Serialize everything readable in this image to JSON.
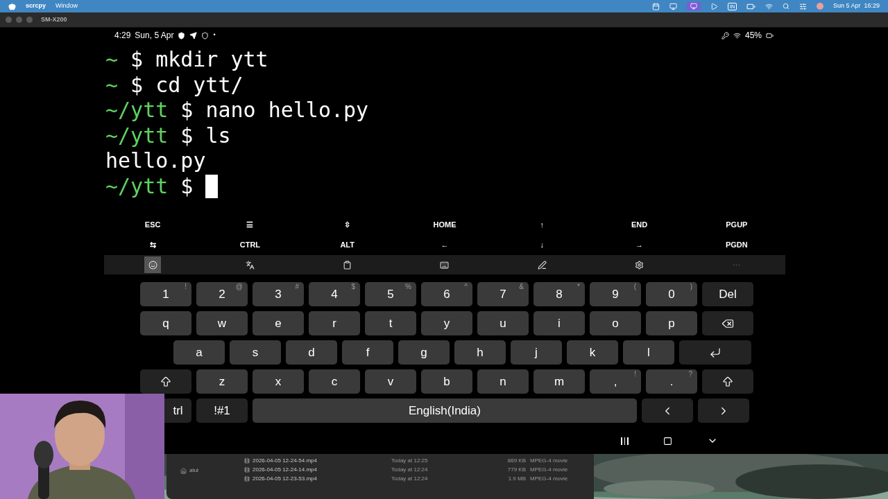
{
  "menubar": {
    "app": "scrcpy",
    "menus": [
      "Window"
    ],
    "input_source": "IN",
    "clock": "Sun 5 Apr  16:29"
  },
  "window": {
    "title": "SM-X200"
  },
  "status_bar": {
    "time": "4:29",
    "date": "Sun, 5 Apr",
    "dot": "•",
    "battery": "45%"
  },
  "terminal": [
    {
      "kind": "command",
      "path": "~",
      "symbol": "$",
      "command": "mkdir ytt"
    },
    {
      "kind": "command",
      "path": "~",
      "symbol": "$",
      "command": "cd ytt/"
    },
    {
      "kind": "command",
      "path": "~/ytt",
      "symbol": "$",
      "command": "nano hello.py"
    },
    {
      "kind": "command",
      "path": "~/ytt",
      "symbol": "$",
      "command": "ls"
    },
    {
      "kind": "output",
      "text": "hello.py"
    },
    {
      "kind": "command",
      "path": "~/ytt",
      "symbol": "$",
      "cursor": true
    }
  ],
  "extra_keys": [
    [
      "ESC",
      "☰",
      "⇳",
      "HOME",
      "↑",
      "END",
      "PGUP"
    ],
    [
      "⇆",
      "CTRL",
      "ALT",
      "←",
      "↓",
      "→",
      "PGDN"
    ]
  ],
  "toolbar": [
    {
      "selected": true
    },
    {
      "selected": false
    },
    {
      "selected": false
    },
    {
      "selected": false
    },
    {
      "selected": false
    },
    {
      "selected": false
    },
    {
      "selected": false
    }
  ],
  "keyboard": [
    [
      {
        "kind": "char",
        "label": "1",
        "hint": "!"
      },
      {
        "kind": "char",
        "label": "2",
        "hint": "@"
      },
      {
        "kind": "char",
        "label": "3",
        "hint": "#"
      },
      {
        "kind": "char",
        "label": "4",
        "hint": "$"
      },
      {
        "kind": "char",
        "label": "5",
        "hint": "%"
      },
      {
        "kind": "char",
        "label": "6",
        "hint": "^"
      },
      {
        "kind": "char",
        "label": "7",
        "hint": "&"
      },
      {
        "kind": "char",
        "label": "8",
        "hint": "*"
      },
      {
        "kind": "char",
        "label": "9",
        "hint": "("
      },
      {
        "kind": "char",
        "label": "0",
        "hint": ")"
      },
      {
        "kind": "function",
        "label": "Del"
      }
    ],
    [
      {
        "kind": "char",
        "label": "q"
      },
      {
        "kind": "char",
        "label": "w"
      },
      {
        "kind": "char",
        "label": "e"
      },
      {
        "kind": "char",
        "label": "r"
      },
      {
        "kind": "char",
        "label": "t"
      },
      {
        "kind": "char",
        "label": "y"
      },
      {
        "kind": "char",
        "label": "u"
      },
      {
        "kind": "char",
        "label": "i"
      },
      {
        "kind": "char",
        "label": "o"
      },
      {
        "kind": "char",
        "label": "p"
      },
      {
        "kind": "backspace"
      }
    ],
    [
      {
        "kind": "char",
        "label": "a"
      },
      {
        "kind": "char",
        "label": "s"
      },
      {
        "kind": "char",
        "label": "d"
      },
      {
        "kind": "char",
        "label": "f"
      },
      {
        "kind": "char",
        "label": "g"
      },
      {
        "kind": "char",
        "label": "h"
      },
      {
        "kind": "char",
        "label": "j"
      },
      {
        "kind": "char",
        "label": "k"
      },
      {
        "kind": "char",
        "label": "l"
      },
      {
        "kind": "enter"
      }
    ],
    [
      {
        "kind": "shift"
      },
      {
        "kind": "char",
        "label": "z"
      },
      {
        "kind": "char",
        "label": "x"
      },
      {
        "kind": "char",
        "label": "c"
      },
      {
        "kind": "char",
        "label": "v"
      },
      {
        "kind": "char",
        "label": "b"
      },
      {
        "kind": "char",
        "label": "n"
      },
      {
        "kind": "char",
        "label": "m"
      },
      {
        "kind": "char",
        "label": ",",
        "hint": "!"
      },
      {
        "kind": "char",
        "label": ".",
        "hint": "?"
      },
      {
        "kind": "shift"
      }
    ],
    [
      {
        "kind": "function",
        "label": "trl"
      },
      {
        "kind": "function",
        "label": "!#1"
      },
      {
        "kind": "space",
        "label": "English(India)"
      },
      {
        "kind": "left"
      },
      {
        "kind": "right"
      }
    ]
  ],
  "finder": {
    "sidebar": [
      "atul"
    ],
    "rows": [
      {
        "name": "2026-04-05 12-24-54.mp4",
        "date": "Today at 12:25",
        "size": "869 KB",
        "kind": "MPEG-4 movie"
      },
      {
        "name": "2026-04-05 12-24-14.mp4",
        "date": "Today at 12:24",
        "size": "779 KB",
        "kind": "MPEG-4 movie"
      },
      {
        "name": "2026-04-05 12-23-53.mp4",
        "date": "Today at 12:24",
        "size": "1.9 MB",
        "kind": "MPEG-4 movie"
      }
    ]
  }
}
